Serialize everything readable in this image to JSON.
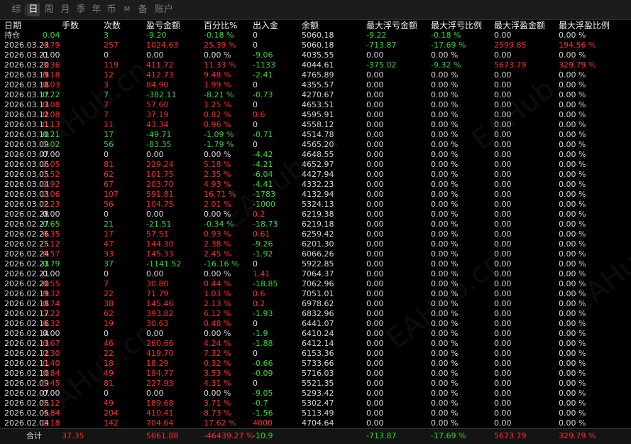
{
  "tabs": [
    "综",
    "日",
    "周",
    "月",
    "季",
    "年",
    "币",
    "M",
    "备",
    "账户"
  ],
  "active_tab": 1,
  "columns": [
    "日期",
    "手数",
    "次数",
    "盈亏金额",
    "百分比%",
    "出入金",
    "余额",
    "最大浮亏金额",
    "最大浮亏比例",
    "最大浮盈金额",
    "最大浮盈比例"
  ],
  "colors": {
    "positive": "#ff2b2b",
    "negative": "#33d933",
    "neutral": "#d8d8d8",
    "header": "#f0f0f0"
  },
  "rows": [
    {
      "c": [
        "持仓",
        "0.04",
        "3",
        "-9.20",
        "-0.18 %",
        "0",
        "5060.18",
        "-9.22",
        "-0.18 %",
        "0.00",
        "0.00 %"
      ],
      "t": [
        "n",
        "g",
        "g",
        "g",
        "g",
        "n",
        "n",
        "g",
        "g",
        "n",
        "n"
      ]
    },
    {
      "c": [
        "2026.03.23",
        "4.79",
        "257",
        "1024.63",
        "25.39 %",
        "0",
        "5060.18",
        "-713.87",
        "-17.69 %",
        "2599.85",
        "194.56 %"
      ],
      "t": [
        "n",
        "r",
        "r",
        "r",
        "r",
        "n",
        "n",
        "g",
        "g",
        "r",
        "r"
      ]
    },
    {
      "c": [
        "2026.03.21",
        "0.00",
        "0",
        "0.00",
        "0.00 %",
        "-9.06",
        "4035.55",
        "0.00",
        "0.00 %",
        "0.00",
        "0.00 %"
      ],
      "t": [
        "n",
        "n",
        "n",
        "n",
        "n",
        "g",
        "n",
        "n",
        "n",
        "n",
        "n"
      ]
    },
    {
      "c": [
        "2026.03.20",
        "3.36",
        "119",
        "411.72",
        "11.33 %",
        "-1133",
        "4044.61",
        "-375.02",
        "-9.32 %",
        "5673.79",
        "329.79 %"
      ],
      "t": [
        "n",
        "r",
        "r",
        "r",
        "r",
        "g",
        "n",
        "g",
        "g",
        "r",
        "r"
      ]
    },
    {
      "c": [
        "2026.03.19",
        "0.18",
        "12",
        "412.73",
        "9.48 %",
        "-2.41",
        "4765.89",
        "0.00",
        "0.00 %",
        "0.00",
        "0.00 %"
      ],
      "t": [
        "n",
        "r",
        "r",
        "r",
        "r",
        "g",
        "n",
        "n",
        "n",
        "n",
        "n"
      ]
    },
    {
      "c": [
        "2026.03.18",
        "0.03",
        "3",
        "84.90",
        "1.99 %",
        "0",
        "4355.57",
        "0.00",
        "0.00 %",
        "0.00",
        "0.00 %"
      ],
      "t": [
        "n",
        "r",
        "r",
        "r",
        "r",
        "n",
        "n",
        "n",
        "n",
        "n",
        "n"
      ]
    },
    {
      "c": [
        "2026.03.17",
        "0.22",
        "7",
        "-382.11",
        "-8.21 %",
        "-0.73",
        "4270.67",
        "0.00",
        "0.00 %",
        "0.00",
        "0.00 %"
      ],
      "t": [
        "n",
        "g",
        "g",
        "g",
        "g",
        "g",
        "n",
        "n",
        "n",
        "n",
        "n"
      ]
    },
    {
      "c": [
        "2026.03.13",
        "0.08",
        "7",
        "57.60",
        "1.25 %",
        "0",
        "4653.51",
        "0.00",
        "0.00 %",
        "0.00",
        "0.00 %"
      ],
      "t": [
        "n",
        "r",
        "r",
        "r",
        "r",
        "n",
        "n",
        "n",
        "n",
        "n",
        "n"
      ]
    },
    {
      "c": [
        "2026.03.12",
        "0.08",
        "7",
        "37.19",
        "0.82 %",
        "0.6",
        "4595.91",
        "0.00",
        "0.00 %",
        "0.00",
        "0.00 %"
      ],
      "t": [
        "n",
        "r",
        "r",
        "r",
        "r",
        "r",
        "n",
        "n",
        "n",
        "n",
        "n"
      ]
    },
    {
      "c": [
        "2026.03.11",
        "0.13",
        "11",
        "43.34",
        "0.96 %",
        "0",
        "4558.12",
        "0.00",
        "0.00 %",
        "0.00",
        "0.00 %"
      ],
      "t": [
        "n",
        "r",
        "r",
        "r",
        "r",
        "n",
        "n",
        "n",
        "n",
        "n",
        "n"
      ]
    },
    {
      "c": [
        "2026.03.10",
        "0.21",
        "17",
        "-49.71",
        "-1.09 %",
        "-0.71",
        "4514.78",
        "0.00",
        "0.00 %",
        "0.00",
        "0.00 %"
      ],
      "t": [
        "n",
        "g",
        "g",
        "g",
        "g",
        "g",
        "n",
        "n",
        "n",
        "n",
        "n"
      ]
    },
    {
      "c": [
        "2026.03.09",
        "1.02",
        "56",
        "-83.35",
        "-1.79 %",
        "0",
        "4565.20",
        "0.00",
        "0.00 %",
        "0.00",
        "0.00 %"
      ],
      "t": [
        "n",
        "g",
        "g",
        "g",
        "g",
        "n",
        "n",
        "n",
        "n",
        "n",
        "n"
      ]
    },
    {
      "c": [
        "2026.03.07",
        "0.00",
        "0",
        "0.00",
        "0.00 %",
        "-4.42",
        "4648.55",
        "0.00",
        "0.00 %",
        "0.00",
        "0.00 %"
      ],
      "t": [
        "n",
        "n",
        "n",
        "n",
        "n",
        "g",
        "n",
        "n",
        "n",
        "n",
        "n"
      ]
    },
    {
      "c": [
        "2026.03.06",
        "2.05",
        "81",
        "229.24",
        "5.18 %",
        "-4.21",
        "4652.97",
        "0.00",
        "0.00 %",
        "0.00",
        "0.00 %"
      ],
      "t": [
        "n",
        "r",
        "r",
        "r",
        "r",
        "g",
        "n",
        "n",
        "n",
        "n",
        "n"
      ]
    },
    {
      "c": [
        "2026.03.05",
        "1.52",
        "62",
        "101.75",
        "2.35 %",
        "-6.04",
        "4427.94",
        "0.00",
        "0.00 %",
        "0.00",
        "0.00 %"
      ],
      "t": [
        "n",
        "r",
        "r",
        "r",
        "r",
        "g",
        "n",
        "n",
        "n",
        "n",
        "n"
      ]
    },
    {
      "c": [
        "2026.03.04",
        "1.92",
        "67",
        "203.70",
        "4.93 %",
        "-4.41",
        "4332.23",
        "0.00",
        "0.00 %",
        "0.00",
        "0.00 %"
      ],
      "t": [
        "n",
        "r",
        "r",
        "r",
        "r",
        "g",
        "n",
        "n",
        "n",
        "n",
        "n"
      ]
    },
    {
      "c": [
        "2026.03.03",
        "2.06",
        "107",
        "591.81",
        "16.71 %",
        "-1783",
        "4132.94",
        "0.00",
        "0.00 %",
        "0.00",
        "0.00 %"
      ],
      "t": [
        "n",
        "r",
        "r",
        "r",
        "r",
        "g",
        "n",
        "n",
        "n",
        "n",
        "n"
      ]
    },
    {
      "c": [
        "2026.03.02",
        "1.23",
        "56",
        "104.75",
        "2.01 %",
        "-1000",
        "5324.13",
        "0.00",
        "0.00 %",
        "0.00",
        "0.00 %"
      ],
      "t": [
        "n",
        "r",
        "r",
        "r",
        "r",
        "g",
        "n",
        "n",
        "n",
        "n",
        "n"
      ]
    },
    {
      "c": [
        "2026.02.28",
        "0.00",
        "0",
        "0.00",
        "0.00 %",
        "0.2",
        "6219.38",
        "0.00",
        "0.00 %",
        "0.00",
        "0.00 %"
      ],
      "t": [
        "n",
        "n",
        "n",
        "n",
        "n",
        "r",
        "n",
        "n",
        "n",
        "n",
        "n"
      ]
    },
    {
      "c": [
        "2026.02.27",
        "0.65",
        "21",
        "-21.51",
        "-0.34 %",
        "-18.73",
        "6219.18",
        "0.00",
        "0.00 %",
        "0.00",
        "0.00 %"
      ],
      "t": [
        "n",
        "g",
        "g",
        "g",
        "g",
        "g",
        "n",
        "n",
        "n",
        "n",
        "n"
      ]
    },
    {
      "c": [
        "2026.02.26",
        "0.35",
        "17",
        "57.51",
        "0.93 %",
        "0.61",
        "6259.42",
        "0.00",
        "0.00 %",
        "0.00",
        "0.00 %"
      ],
      "t": [
        "n",
        "r",
        "r",
        "r",
        "r",
        "r",
        "n",
        "n",
        "n",
        "n",
        "n"
      ]
    },
    {
      "c": [
        "2026.02.25",
        "1.12",
        "47",
        "144.30",
        "2.38 %",
        "-9.26",
        "6201.30",
        "0.00",
        "0.00 %",
        "0.00",
        "0.00 %"
      ],
      "t": [
        "n",
        "r",
        "r",
        "r",
        "r",
        "g",
        "n",
        "n",
        "n",
        "n",
        "n"
      ]
    },
    {
      "c": [
        "2026.02.24",
        "0.57",
        "33",
        "145.33",
        "2.45 %",
        "-1.92",
        "6066.26",
        "0.00",
        "0.00 %",
        "0.00",
        "0.00 %"
      ],
      "t": [
        "n",
        "r",
        "r",
        "r",
        "r",
        "g",
        "n",
        "n",
        "n",
        "n",
        "n"
      ]
    },
    {
      "c": [
        "2026.02.23",
        "0.79",
        "37",
        "-1141.52",
        "-16.16 %",
        "0",
        "5922.85",
        "0.00",
        "0.00 %",
        "0.00",
        "0.00 %"
      ],
      "t": [
        "n",
        "g",
        "g",
        "g",
        "g",
        "n",
        "n",
        "n",
        "n",
        "n",
        "n"
      ]
    },
    {
      "c": [
        "2026.02.21",
        "0.00",
        "0",
        "0.00",
        "0.00 %",
        "1.41",
        "7064.37",
        "0.00",
        "0.00 %",
        "0.00",
        "0.00 %"
      ],
      "t": [
        "n",
        "n",
        "n",
        "n",
        "n",
        "r",
        "n",
        "n",
        "n",
        "n",
        "n"
      ]
    },
    {
      "c": [
        "2026.02.20",
        "0.55",
        "7",
        "30.80",
        "0.44 %",
        "-18.85",
        "7062.96",
        "0.00",
        "0.00 %",
        "0.00",
        "0.00 %"
      ],
      "t": [
        "n",
        "r",
        "r",
        "r",
        "r",
        "g",
        "n",
        "n",
        "n",
        "n",
        "n"
      ]
    },
    {
      "c": [
        "2026.02.19",
        "0.32",
        "22",
        "71.79",
        "1.03 %",
        "0.6",
        "7051.01",
        "0.00",
        "0.00 %",
        "0.00",
        "0.00 %"
      ],
      "t": [
        "n",
        "r",
        "r",
        "r",
        "r",
        "r",
        "n",
        "n",
        "n",
        "n",
        "n"
      ]
    },
    {
      "c": [
        "2026.02.18",
        "0.74",
        "38",
        "145.46",
        "2.13 %",
        "0.2",
        "6978.62",
        "0.00",
        "0.00 %",
        "0.00",
        "0.00 %"
      ],
      "t": [
        "n",
        "r",
        "r",
        "r",
        "r",
        "r",
        "n",
        "n",
        "n",
        "n",
        "n"
      ]
    },
    {
      "c": [
        "2026.02.17",
        "1.22",
        "62",
        "393.82",
        "6.12 %",
        "-1.93",
        "6832.96",
        "0.00",
        "0.00 %",
        "0.00",
        "0.00 %"
      ],
      "t": [
        "n",
        "r",
        "r",
        "r",
        "r",
        "g",
        "n",
        "n",
        "n",
        "n",
        "n"
      ]
    },
    {
      "c": [
        "2026.02.16",
        "0.32",
        "19",
        "30.63",
        "0.48 %",
        "0",
        "6441.07",
        "0.00",
        "0.00 %",
        "0.00",
        "0.00 %"
      ],
      "t": [
        "n",
        "r",
        "r",
        "r",
        "r",
        "n",
        "n",
        "n",
        "n",
        "n",
        "n"
      ]
    },
    {
      "c": [
        "2026.02.14",
        "0.00",
        "0",
        "0.00",
        "0.00 %",
        "-1.9",
        "6410.24",
        "0.00",
        "0.00 %",
        "0.00",
        "0.00 %"
      ],
      "t": [
        "n",
        "n",
        "n",
        "n",
        "n",
        "g",
        "n",
        "n",
        "n",
        "n",
        "n"
      ]
    },
    {
      "c": [
        "2026.02.13",
        "0.67",
        "46",
        "260.66",
        "4.24 %",
        "-1.88",
        "6412.14",
        "0.00",
        "0.00 %",
        "0.00",
        "0.00 %"
      ],
      "t": [
        "n",
        "r",
        "r",
        "r",
        "r",
        "g",
        "n",
        "n",
        "n",
        "n",
        "n"
      ]
    },
    {
      "c": [
        "2026.02.12",
        "0.30",
        "22",
        "419.70",
        "7.32 %",
        "0",
        "6153.36",
        "0.00",
        "0.00 %",
        "0.00",
        "0.00 %"
      ],
      "t": [
        "n",
        "r",
        "r",
        "r",
        "r",
        "n",
        "n",
        "n",
        "n",
        "n",
        "n"
      ]
    },
    {
      "c": [
        "2026.02.11",
        "0.40",
        "18",
        "18.29",
        "0.32 %",
        "-0.66",
        "5733.66",
        "0.00",
        "0.00 %",
        "0.00",
        "0.00 %"
      ],
      "t": [
        "n",
        "r",
        "r",
        "r",
        "r",
        "g",
        "n",
        "n",
        "n",
        "n",
        "n"
      ]
    },
    {
      "c": [
        "2026.02.10",
        "0.84",
        "49",
        "194.77",
        "3.53 %",
        "-0.09",
        "5716.03",
        "0.00",
        "0.00 %",
        "0.00",
        "0.00 %"
      ],
      "t": [
        "n",
        "r",
        "r",
        "r",
        "r",
        "g",
        "n",
        "n",
        "n",
        "n",
        "n"
      ]
    },
    {
      "c": [
        "2026.02.09",
        "1.45",
        "81",
        "227.93",
        "4.31 %",
        "0",
        "5521.35",
        "0.00",
        "0.00 %",
        "0.00",
        "0.00 %"
      ],
      "t": [
        "n",
        "r",
        "r",
        "r",
        "r",
        "n",
        "n",
        "n",
        "n",
        "n",
        "n"
      ]
    },
    {
      "c": [
        "2026.02.07",
        "0.00",
        "0",
        "0.00",
        "0.00 %",
        "-9.05",
        "5293.42",
        "0.00",
        "0.00 %",
        "0.00",
        "0.00 %"
      ],
      "t": [
        "n",
        "n",
        "n",
        "n",
        "n",
        "g",
        "n",
        "n",
        "n",
        "n",
        "n"
      ]
    },
    {
      "c": [
        "2026.02.06",
        "1.12",
        "49",
        "189.68",
        "3.71 %",
        "-0.7",
        "5302.47",
        "0.00",
        "0.00 %",
        "0.00",
        "0.00 %"
      ],
      "t": [
        "n",
        "r",
        "r",
        "r",
        "r",
        "g",
        "n",
        "n",
        "n",
        "n",
        "n"
      ]
    },
    {
      "c": [
        "2026.02.05",
        "4.84",
        "204",
        "410.41",
        "8.73 %",
        "-1.56",
        "5113.49",
        "0.00",
        "0.00 %",
        "0.00",
        "0.00 %"
      ],
      "t": [
        "n",
        "r",
        "r",
        "r",
        "r",
        "g",
        "n",
        "n",
        "n",
        "n",
        "n"
      ]
    },
    {
      "c": [
        "2026.02.04",
        "2.18",
        "142",
        "704.64",
        "17.62 %",
        "4000",
        "4704.64",
        "0.00",
        "0.00 %",
        "0.00",
        "0.00 %"
      ],
      "t": [
        "n",
        "r",
        "r",
        "r",
        "r",
        "r",
        "n",
        "n",
        "n",
        "n",
        "n"
      ]
    }
  ],
  "footer": {
    "c": [
      "合计",
      "37.35",
      "",
      "5061.88",
      "-46439.27 %",
      "-10.9",
      "",
      "-713.87",
      "-17.69 %",
      "5673.79",
      "329.79 %"
    ],
    "t": [
      "n",
      "r",
      "n",
      "r",
      "r",
      "g",
      "n",
      "g",
      "g",
      "r",
      "r"
    ]
  },
  "watermark": "EAHub.cn"
}
